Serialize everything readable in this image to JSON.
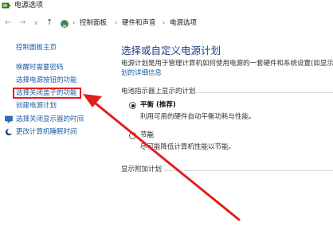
{
  "window": {
    "title": "电源选项"
  },
  "address_bar": {
    "back": "←",
    "forward": "→",
    "recent": "∨",
    "up": "↑",
    "crumbs": [
      "控制面板",
      "硬件和声音",
      "电源选项"
    ],
    "separator": "›"
  },
  "sidebar": {
    "home": "控制面板主页",
    "items": [
      "唤醒时需要密码",
      "选择电源按钮的功能",
      "选择关闭盖子的功能",
      "创建电源计划",
      "选择关闭显示器的时间",
      "更改计算机睡眠时间"
    ]
  },
  "main": {
    "heading": "选择或自定义电源计划",
    "description": "电源计划是用于管理计算机如何使用电源的一套硬件和系统设置(如显示器",
    "description_link": "划的详细信息",
    "battery_section": "电池指示器上显示的计划",
    "plans": [
      {
        "name": "平衡 (推荐)",
        "desc": "利用可用的硬件自动平衡功耗与性能。",
        "selected": true
      },
      {
        "name": "节能",
        "desc": "尽可能降低计算机性能以节能。",
        "selected": false
      }
    ],
    "additional_section": "显示附加计划"
  },
  "colors": {
    "link": "#1c5fa5",
    "heading": "#1e3f8a",
    "annotation": "#e0201d"
  }
}
